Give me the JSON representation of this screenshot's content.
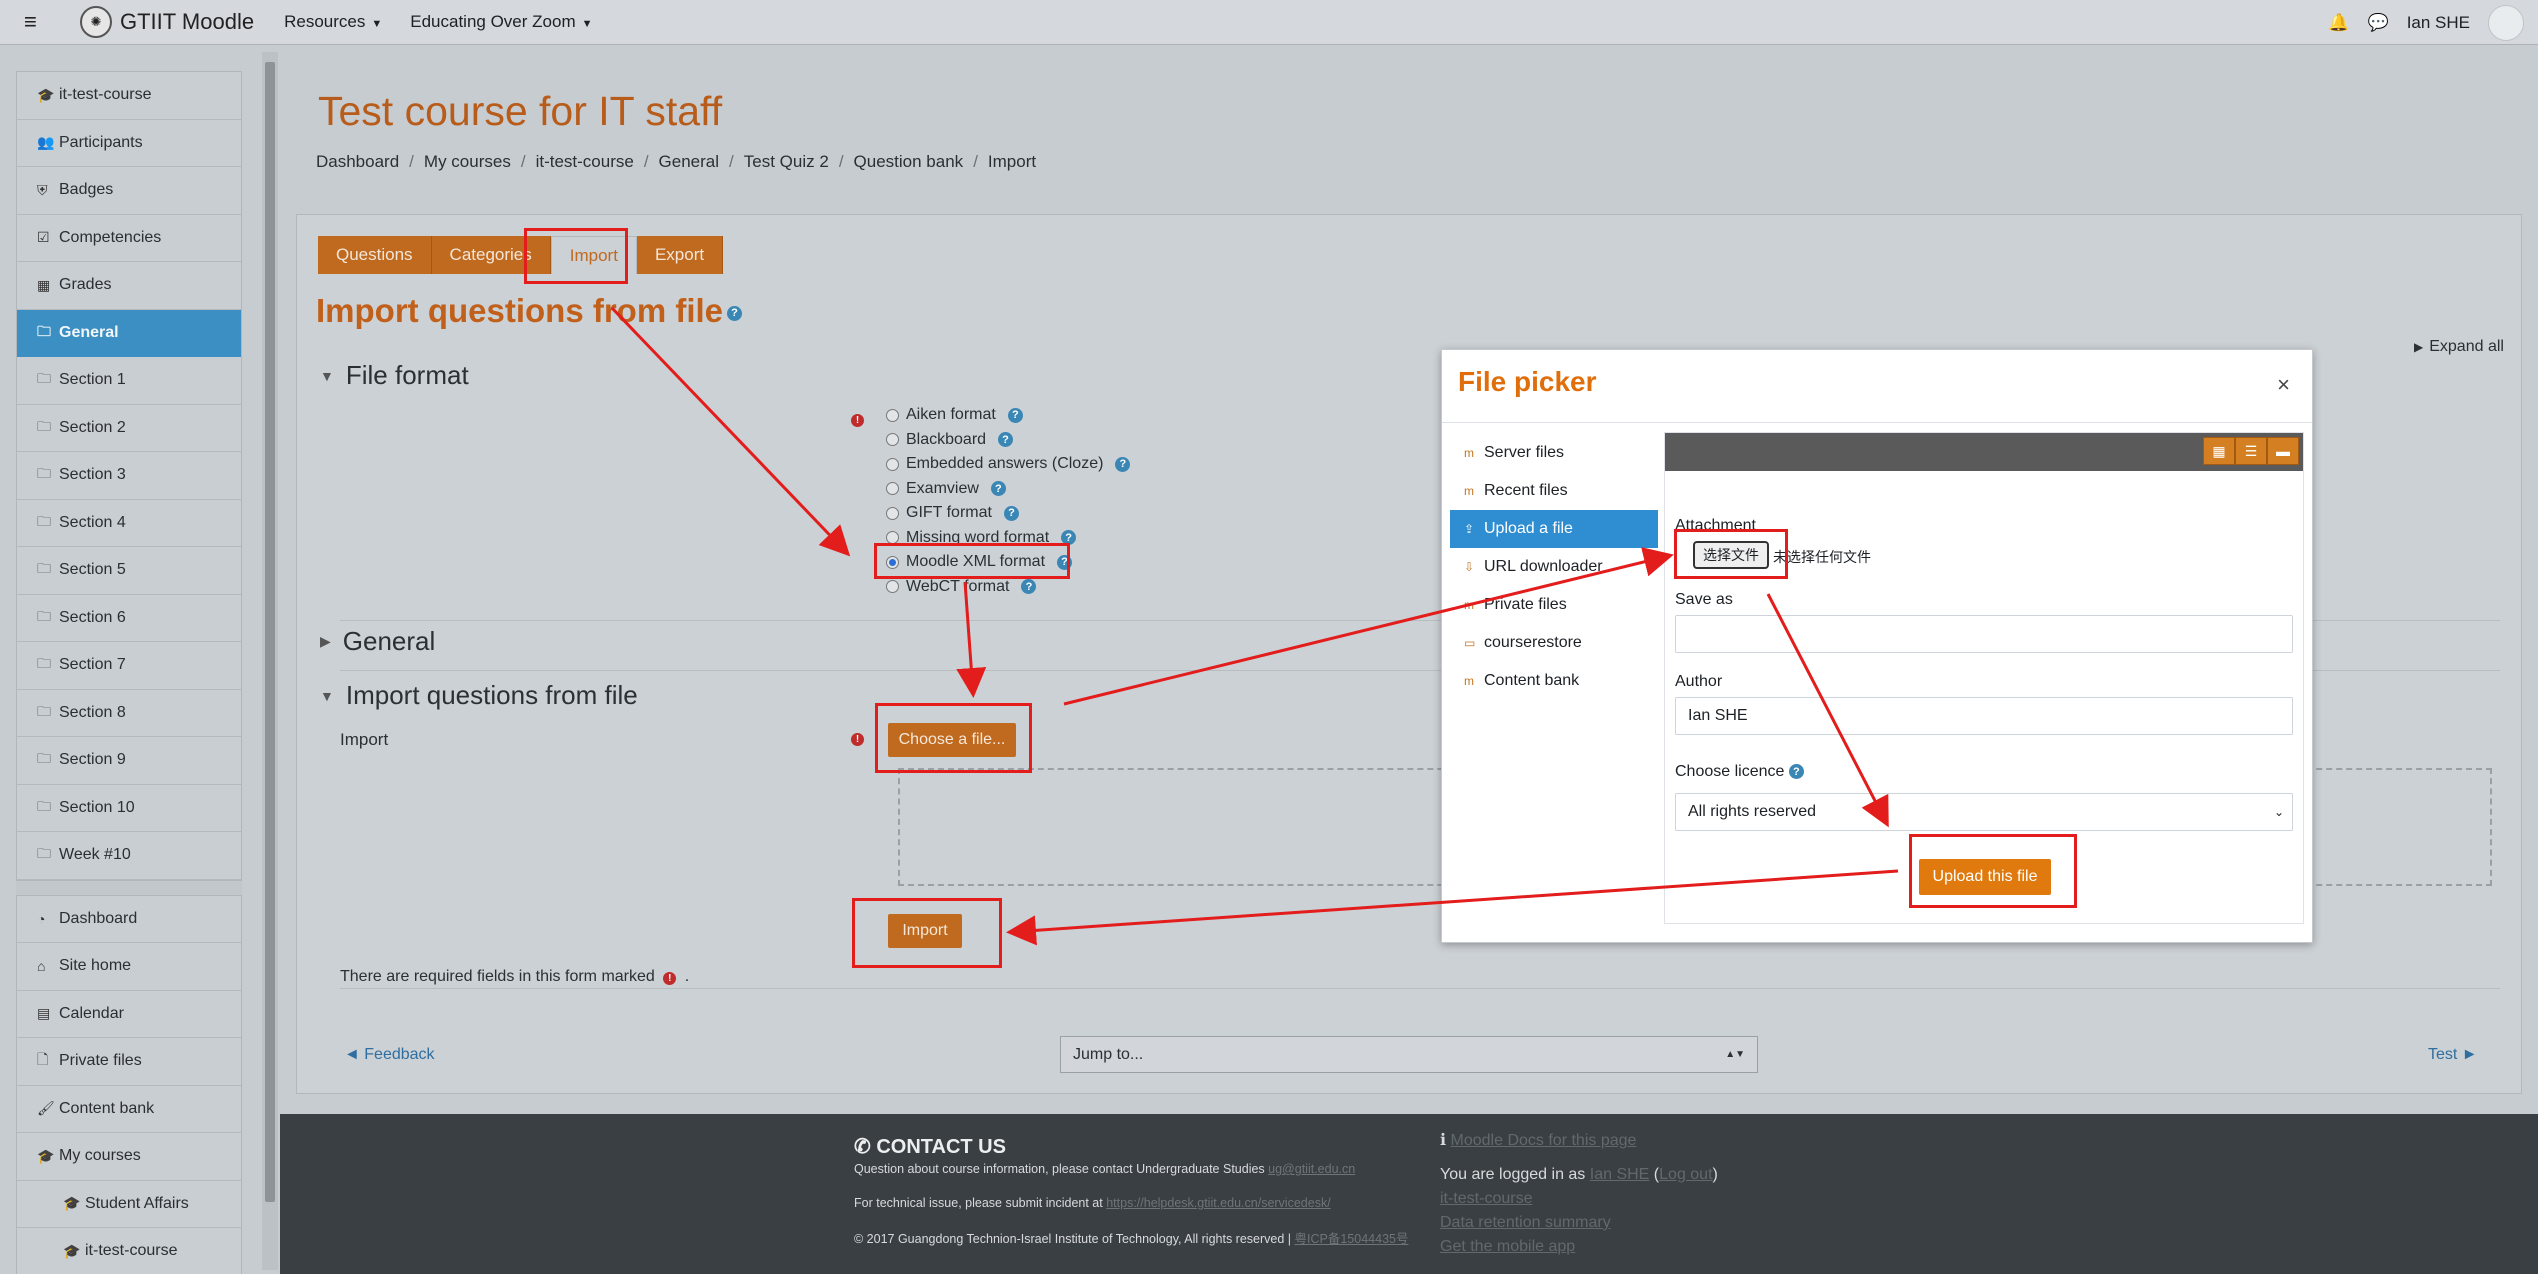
{
  "topbar": {
    "brand": "GTIIT Moodle",
    "nav": [
      {
        "label": "Resources"
      },
      {
        "label": "Educating Over Zoom"
      }
    ],
    "user_name": "Ian SHE"
  },
  "sidebar": {
    "course_items": [
      {
        "label": "it-test-course",
        "icon": "mortarboard-icon",
        "glyph": "🎓"
      },
      {
        "label": "Participants",
        "icon": "users-icon",
        "glyph": "👥"
      },
      {
        "label": "Badges",
        "icon": "shield-icon",
        "glyph": "⛨"
      },
      {
        "label": "Competencies",
        "icon": "checkbox-icon",
        "glyph": "☑"
      },
      {
        "label": "Grades",
        "icon": "table-icon",
        "glyph": "▦"
      },
      {
        "label": "General",
        "icon": "folder-icon",
        "glyph": "🗀",
        "active": true
      },
      {
        "label": "Section 1",
        "icon": "folder-icon",
        "glyph": "🗀"
      },
      {
        "label": "Section 2",
        "icon": "folder-icon",
        "glyph": "🗀"
      },
      {
        "label": "Section 3",
        "icon": "folder-icon",
        "glyph": "🗀"
      },
      {
        "label": "Section 4",
        "icon": "folder-icon",
        "glyph": "🗀"
      },
      {
        "label": "Section 5",
        "icon": "folder-icon",
        "glyph": "🗀"
      },
      {
        "label": "Section 6",
        "icon": "folder-icon",
        "glyph": "🗀"
      },
      {
        "label": "Section 7",
        "icon": "folder-icon",
        "glyph": "🗀"
      },
      {
        "label": "Section 8",
        "icon": "folder-icon",
        "glyph": "🗀"
      },
      {
        "label": "Section 9",
        "icon": "folder-icon",
        "glyph": "🗀"
      },
      {
        "label": "Section 10",
        "icon": "folder-icon",
        "glyph": "🗀"
      },
      {
        "label": "Week #10",
        "icon": "folder-icon",
        "glyph": "🗀"
      }
    ],
    "site_items": [
      {
        "label": "Dashboard",
        "icon": "dashboard-icon",
        "glyph": "◔"
      },
      {
        "label": "Site home",
        "icon": "home-icon",
        "glyph": "⌂"
      },
      {
        "label": "Calendar",
        "icon": "calendar-icon",
        "glyph": "▤"
      },
      {
        "label": "Private files",
        "icon": "file-icon",
        "glyph": "🗋"
      },
      {
        "label": "Content bank",
        "icon": "paintbrush-icon",
        "glyph": "🖌"
      },
      {
        "label": "My courses",
        "icon": "mortarboard-icon",
        "glyph": "🎓"
      },
      {
        "label": "Student Affairs",
        "icon": "mortarboard-icon",
        "glyph": "🎓",
        "indent": true
      },
      {
        "label": "it-test-course",
        "icon": "mortarboard-icon",
        "glyph": "🎓",
        "indent": true
      }
    ]
  },
  "page": {
    "course_title": "Test course for IT staff",
    "breadcrumb": [
      "Dashboard",
      "My courses",
      "it-test-course",
      "General",
      "Test Quiz 2",
      "Question bank",
      "Import"
    ],
    "tabs": [
      {
        "label": "Questions"
      },
      {
        "label": "Categories"
      },
      {
        "label": "Import",
        "active": true
      },
      {
        "label": "Export"
      }
    ],
    "heading": "Import questions from file",
    "expand_all": "Expand all"
  },
  "form": {
    "file_format_heading": "File format",
    "formats": [
      {
        "label": "Aiken format"
      },
      {
        "label": "Blackboard"
      },
      {
        "label": "Embedded answers (Cloze)"
      },
      {
        "label": "Examview"
      },
      {
        "label": "GIFT format"
      },
      {
        "label": "Missing word format"
      },
      {
        "label": "Moodle XML format",
        "checked": true
      },
      {
        "label": "WebCT format"
      }
    ],
    "general_heading": "General",
    "import_heading": "Import questions from file",
    "import_label": "Import",
    "choose_file_button": "Choose a file...",
    "import_button": "Import",
    "required_note": "There are required fields in this form marked",
    "required_note_end": "."
  },
  "nav": {
    "prev": "◄ Feedback",
    "jump_to": "Jump to...",
    "next": "Test ►"
  },
  "footer": {
    "contact_title": "CONTACT US",
    "line1": "Question about course information, please contact Undergraduate Studies",
    "line1_link": "ug@gtiit.edu.cn",
    "line2": "For technical issue, please submit incident at",
    "line2_link": "https://helpdesk.gtiit.edu.cn/servicedesk/",
    "line3": "© 2017 Guangdong Technion-Israel Institute of Technology, All rights reserved |",
    "line3_link": "粤ICP备15044435号",
    "docs_link": "Moodle Docs for this page",
    "logged_in_prefix": "You are logged in as",
    "logged_in_user": "Ian SHE",
    "logout": "Log out",
    "course_link": "it-test-course",
    "retention_link": "Data retention summary",
    "mobile_link": "Get the mobile app"
  },
  "file_picker": {
    "title": "File picker",
    "repositories": [
      {
        "label": "Server files",
        "icon": "moodle-icon"
      },
      {
        "label": "Recent files",
        "icon": "moodle-icon"
      },
      {
        "label": "Upload a file",
        "icon": "upload-icon",
        "active": true
      },
      {
        "label": "URL downloader",
        "icon": "download-icon"
      },
      {
        "label": "Private files",
        "icon": "moodle-icon"
      },
      {
        "label": "courserestore",
        "icon": "box-icon"
      },
      {
        "label": "Content bank",
        "icon": "moodle-icon"
      }
    ],
    "attachment_label": "Attachment",
    "choose_file_native": "选择文件",
    "no_file_chosen": "未选择任何文件",
    "save_as_label": "Save as",
    "save_as_value": "",
    "author_label": "Author",
    "author_value": "Ian SHE",
    "licence_label": "Choose licence",
    "licence_value": "All rights reserved",
    "upload_button": "Upload this file"
  },
  "colors": {
    "accent": "#c06a1f",
    "active_nav": "#3b8fc2",
    "annotation": "#e31c1c",
    "modal_title": "#e06f0b"
  }
}
